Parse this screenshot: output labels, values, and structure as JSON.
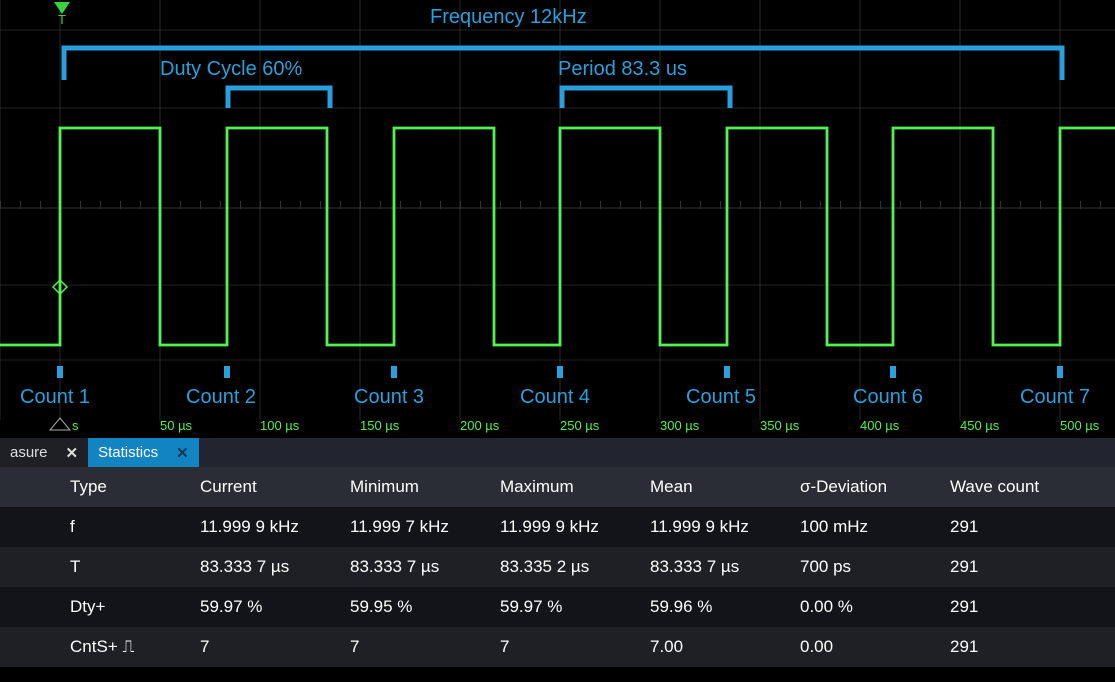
{
  "annotations": {
    "frequency": "Frequency 12kHz",
    "duty_cycle": "Duty Cycle 60%",
    "period": "Period 83.3 us",
    "counts": [
      "Count 1",
      "Count 2",
      "Count 3",
      "Count 4",
      "Count 5",
      "Count 6",
      "Count 7"
    ]
  },
  "time_axis": {
    "origin_unit": "s",
    "ticks": [
      "50 µs",
      "100 µs",
      "150 µs",
      "200 µs",
      "250 µs",
      "300 µs",
      "350 µs",
      "400 µs",
      "450 µs",
      "500 µs"
    ]
  },
  "tabs": {
    "measure": "asure",
    "statistics": "Statistics"
  },
  "stats": {
    "headers": [
      "Type",
      "Current",
      "Minimum",
      "Maximum",
      "Mean",
      "σ-Deviation",
      "Wave count"
    ],
    "rows": [
      {
        "type": "f",
        "current": "11.999 9 kHz",
        "min": "11.999 7 kHz",
        "max": "11.999 9 kHz",
        "mean": "11.999 9 kHz",
        "dev": "100 mHz",
        "wc": "291"
      },
      {
        "type": "T",
        "current": "83.333 7 µs",
        "min": "83.333 7 µs",
        "max": "83.335 2 µs",
        "mean": "83.333 7 µs",
        "dev": "700 ps",
        "wc": "291"
      },
      {
        "type": "Dty+",
        "current": "59.97 %",
        "min": "59.95 %",
        "max": "59.97 %",
        "mean": "59.96 %",
        "dev": "0.00 %",
        "wc": "291"
      },
      {
        "type": "CntS+ ⎍",
        "current": "7",
        "min": "7",
        "max": "7",
        "mean": "7.00",
        "dev": "0.00",
        "wc": "291"
      }
    ]
  },
  "trigger_marker_label": "T"
}
